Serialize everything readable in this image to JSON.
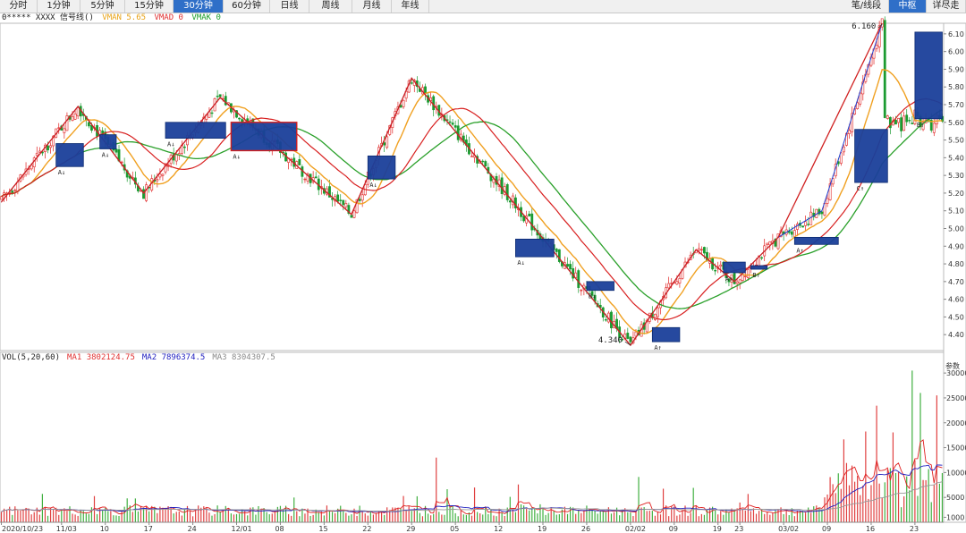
{
  "toolbar": {
    "tabs": [
      {
        "label": "分时",
        "active": false
      },
      {
        "label": "1分钟",
        "active": false
      },
      {
        "label": "5分钟",
        "active": false
      },
      {
        "label": "15分钟",
        "active": false
      },
      {
        "label": "30分钟",
        "active": true
      },
      {
        "label": "60分钟",
        "active": false
      },
      {
        "label": "日线",
        "active": false
      },
      {
        "label": "周线",
        "active": false
      },
      {
        "label": "月线",
        "active": false
      },
      {
        "label": "年线",
        "active": false
      }
    ],
    "right_tabs": [
      {
        "label": "笔/线段",
        "active": false
      },
      {
        "label": "中枢",
        "active": true
      },
      {
        "label": "详尽走",
        "active": false
      }
    ]
  },
  "indicator": {
    "name": "0***** XXXX 信号线()",
    "items": [
      {
        "label": "VMAN 5.65",
        "color": "#e8a317"
      },
      {
        "label": "VMAD 0",
        "color": "#e03030"
      },
      {
        "label": "VMAK 0",
        "color": "#1a9e2a"
      }
    ]
  },
  "volume_legend": {
    "name": "VOL(5,20,60)",
    "items": [
      {
        "label": "MA1 3802124.75",
        "color": "#e03030"
      },
      {
        "label": "MA2 7896374.5",
        "color": "#2020c0"
      },
      {
        "label": "MA3 8304307.5",
        "color": "#888888"
      }
    ]
  },
  "price_axis": {
    "ticks": [
      6.1,
      6.0,
      5.9,
      5.8,
      5.7,
      5.6,
      5.5,
      5.4,
      5.3,
      5.2,
      5.1,
      5.0,
      4.9,
      4.8,
      4.7,
      4.6,
      4.5,
      4.4
    ]
  },
  "volume_axis": {
    "ticks": [
      "30000",
      "25000",
      "20000",
      "15000",
      "10000",
      "5000",
      "1000"
    ]
  },
  "x_labels": [
    "2020/10/23",
    "11/03",
    "10",
    "17",
    "24",
    "12/01",
    "08",
    "15",
    "22",
    "29",
    "05",
    "12",
    "19",
    "26",
    "02/02",
    "09",
    "19",
    "23",
    "03/02",
    "09",
    "16",
    "23"
  ],
  "annotations": {
    "high": "6.160",
    "low": "4.340",
    "scroll_label": "参数"
  },
  "center_labels": [
    "A↓",
    "A↓",
    "A↓",
    "A↓",
    "A↓",
    "B↓",
    "A↑",
    "A↑",
    "B↑",
    "A↑",
    "B↑",
    "C↑",
    "B↑"
  ],
  "chart_data": {
    "type": "candlestick",
    "ylim": [
      4.31,
      6.16
    ],
    "high": 6.16,
    "low": 4.34,
    "zigzag_pivots": [
      {
        "i": 0,
        "p": 5.15
      },
      {
        "i": 28,
        "p": 5.69
      },
      {
        "i": 52,
        "p": 5.2
      },
      {
        "i": 80,
        "p": 5.74
      },
      {
        "i": 128,
        "p": 5.08
      },
      {
        "i": 150,
        "p": 5.85
      },
      {
        "i": 230,
        "p": 4.34
      },
      {
        "i": 254,
        "p": 4.88
      },
      {
        "i": 268,
        "p": 4.7
      },
      {
        "i": 284,
        "p": 4.95
      },
      {
        "i": 300,
        "p": 5.1
      },
      {
        "i": 322,
        "p": 6.16
      }
    ],
    "segment_pivots": [
      {
        "i": 0,
        "p": 5.15
      },
      {
        "i": 28,
        "p": 5.69
      },
      {
        "i": 52,
        "p": 5.2
      },
      {
        "i": 80,
        "p": 5.74
      },
      {
        "i": 128,
        "p": 5.08
      },
      {
        "i": 150,
        "p": 5.85
      },
      {
        "i": 230,
        "p": 4.34
      },
      {
        "i": 254,
        "p": 4.88
      },
      {
        "i": 268,
        "p": 4.7
      },
      {
        "i": 284,
        "p": 4.95
      },
      {
        "i": 322,
        "p": 6.16
      }
    ],
    "centers": [
      {
        "i0": 20,
        "i1": 30,
        "lo": 5.35,
        "hi": 5.48,
        "label": "A↓"
      },
      {
        "i0": 36,
        "i1": 42,
        "lo": 5.45,
        "hi": 5.53,
        "label": "A↓"
      },
      {
        "i0": 60,
        "i1": 82,
        "lo": 5.51,
        "hi": 5.6,
        "label": "A↓"
      },
      {
        "i0": 84,
        "i1": 108,
        "lo": 5.44,
        "hi": 5.6,
        "label": "A↓"
      },
      {
        "i0": 134,
        "i1": 144,
        "lo": 5.28,
        "hi": 5.41,
        "label": "A↓"
      },
      {
        "i0": 188,
        "i1": 202,
        "lo": 4.84,
        "hi": 4.94,
        "label": "A↓"
      },
      {
        "i0": 214,
        "i1": 224,
        "lo": 4.65,
        "hi": 4.7,
        "label": "B↓"
      },
      {
        "i0": 238,
        "i1": 248,
        "lo": 4.36,
        "hi": 4.44,
        "label": "A↑"
      },
      {
        "i0": 264,
        "i1": 272,
        "lo": 4.75,
        "hi": 4.81,
        "label": "A↑"
      },
      {
        "i0": 274,
        "i1": 280,
        "lo": 4.77,
        "hi": 4.79,
        "label": "B↑"
      },
      {
        "i0": 290,
        "i1": 306,
        "lo": 4.91,
        "hi": 4.95,
        "label": "A↑"
      },
      {
        "i0": 312,
        "i1": 324,
        "lo": 5.26,
        "hi": 5.56,
        "label": "C↑"
      },
      {
        "i0": 334,
        "i1": 344,
        "lo": 5.62,
        "hi": 6.11,
        "label": "B↑"
      }
    ],
    "volume_ylim": [
      0,
      32000
    ]
  }
}
